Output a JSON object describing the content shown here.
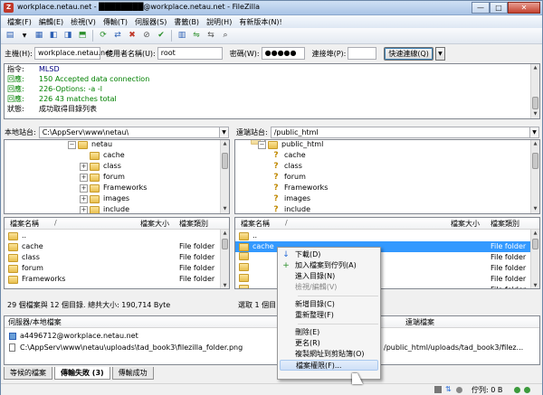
{
  "title": "workplace.netau.net - ████████@workplace.netau.net - FileZilla",
  "menu": [
    "檔案(F)",
    "編輯(E)",
    "檢視(V)",
    "傳輸(T)",
    "伺服器(S)",
    "書籤(B)",
    "說明(H)",
    "有新版本(N)!"
  ],
  "quickconnect": {
    "host_label": "主機(H):",
    "host_value": "workplace.netau.net",
    "user_label": "使用者名稱(U):",
    "user_value": "root",
    "pass_label": "密碼(W):",
    "pass_value": "●●●●●",
    "port_label": "連接埠(P):",
    "port_value": "",
    "button": "快速連線(Q)"
  },
  "log": [
    {
      "k": "指令:",
      "v": "MLSD",
      "c": "#000080"
    },
    {
      "k": "回應:",
      "v": "150 Accepted data connection",
      "c": "#008000"
    },
    {
      "k": "回應:",
      "v": "226-Options: -a -l",
      "c": "#008000"
    },
    {
      "k": "回應:",
      "v": "226 43 matches total",
      "c": "#008000"
    },
    {
      "k": "狀態:",
      "v": "成功取得目錄列表",
      "c": "#000"
    }
  ],
  "local": {
    "site_label": "本地站台:",
    "path": "C:\\AppServ\\www\\netau\\",
    "tree": [
      "netau",
      "cache",
      "class",
      "forum",
      "Frameworks",
      "images",
      "include"
    ],
    "headers": {
      "name": "檔案名稱",
      "size": "檔案大小",
      "type": "檔案類別"
    },
    "files": [
      {
        "name": "..",
        "type": ""
      },
      {
        "name": "cache",
        "type": "File folder"
      },
      {
        "name": "class",
        "type": "File folder"
      },
      {
        "name": "forum",
        "type": "File folder"
      },
      {
        "name": "Frameworks",
        "type": "File folder"
      }
    ],
    "status": "29 個檔案與 12 個目錄. 總共大小: 190,714 Byte"
  },
  "remote": {
    "site_label": "遠端站台:",
    "path": "/public_html",
    "tree_root": "/",
    "tree": [
      "public_html",
      "cache",
      "class",
      "forum",
      "Frameworks",
      "images",
      "include"
    ],
    "headers": {
      "name": "檔案名稱",
      "size": "檔案大小",
      "type": "檔案類別"
    },
    "files": [
      {
        "name": "..",
        "type": ""
      },
      {
        "name": "cache",
        "type": "File folder"
      },
      {
        "name": "",
        "type": "File folder"
      },
      {
        "name": "",
        "type": "File folder"
      },
      {
        "name": "",
        "type": "File folder"
      },
      {
        "name": "",
        "type": "File folder"
      }
    ],
    "status": "選取 1 個目"
  },
  "queue": {
    "headers": {
      "server": "伺服器/本地檔案",
      "remote": "遠端檔案"
    },
    "rows": [
      {
        "left": "a4496712@workplace.netau.net",
        "right": ""
      },
      {
        "left": "C:\\AppServ\\www\\netau\\uploads\\tad_book3\\filezilla_folder.png",
        "right": "/public_html/uploads/tad_book3/filez..."
      }
    ]
  },
  "tabs": [
    "等候的檔案",
    "傳輸失敗 (3)",
    "傳輸成功"
  ],
  "statusbar": {
    "queue": "佇列: 0 B"
  },
  "context_menu": [
    {
      "label": "下載(D)",
      "icon": "↓",
      "color": "#2a6dd8",
      "state": "normal"
    },
    {
      "label": "加入檔案到佇列(A)",
      "icon": "+",
      "color": "#2a8f2a",
      "state": "normal"
    },
    {
      "label": "進入目錄(N)",
      "icon": "",
      "state": "normal"
    },
    {
      "label": "檢視/編輯(V)",
      "icon": "",
      "state": "disabled"
    },
    {
      "sep": true
    },
    {
      "label": "新增目錄(C)",
      "icon": "",
      "state": "normal"
    },
    {
      "label": "重新整理(F)",
      "icon": "",
      "state": "normal"
    },
    {
      "sep": true
    },
    {
      "label": "刪除(E)",
      "icon": "",
      "state": "normal"
    },
    {
      "label": "更名(R)",
      "icon": "",
      "state": "normal"
    },
    {
      "label": "複製網址到剪貼簿(O)",
      "icon": "",
      "state": "normal"
    },
    {
      "label": "檔案權限(F)...",
      "icon": "",
      "state": "highlighted"
    }
  ]
}
